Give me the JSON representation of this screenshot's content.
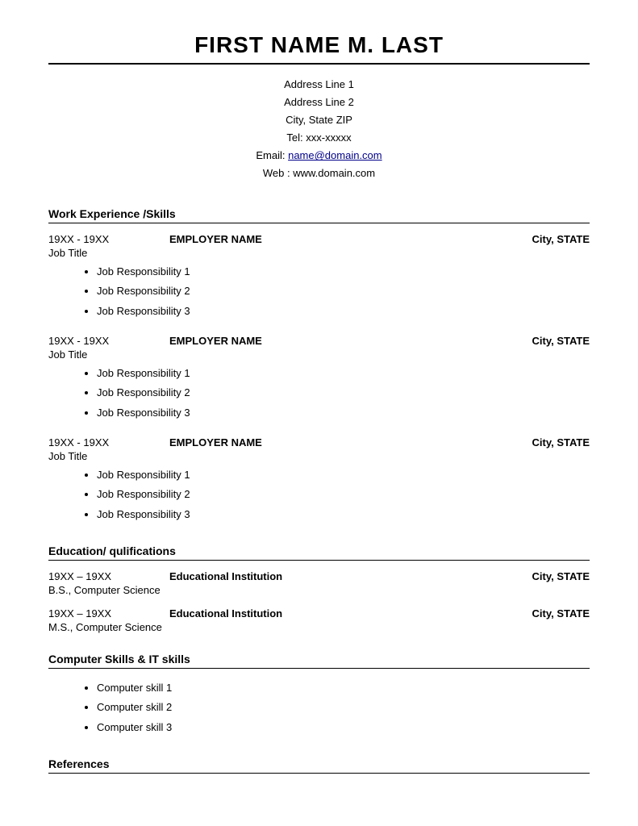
{
  "header": {
    "name": "FIRST NAME M. LAST",
    "address_line1": "Address Line 1",
    "address_line2": "Address Line 2",
    "city_state_zip": "City, State ZIP",
    "tel": "Tel: xxx-xxxxx",
    "email_label": "Email: ",
    "email_value": "name@domain.com",
    "email_href": "mailto:name@domain.com",
    "web": "Web : www.domain.com"
  },
  "work_section": {
    "title": "Work Experience /Skills",
    "jobs": [
      {
        "dates": "19XX - 19XX",
        "employer": "EMPLOYER NAME",
        "location": "City, STATE",
        "title": "Job Title",
        "responsibilities": [
          "Job Responsibility 1",
          "Job Responsibility 2",
          "Job Responsibility 3"
        ]
      },
      {
        "dates": "19XX - 19XX",
        "employer": "EMPLOYER NAME",
        "location": "City, STATE",
        "title": "Job Title",
        "responsibilities": [
          "Job Responsibility 1",
          "Job Responsibility 2",
          "Job Responsibility 3"
        ]
      },
      {
        "dates": "19XX - 19XX",
        "employer": "EMPLOYER NAME",
        "location": "City, STATE",
        "title": "Job Title",
        "responsibilities": [
          "Job Responsibility 1",
          "Job Responsibility 2",
          "Job Responsibility 3"
        ]
      }
    ]
  },
  "education_section": {
    "title": "Education/ qulifications",
    "entries": [
      {
        "dates": "19XX – 19XX",
        "institution": "Educational Institution",
        "location": "City, STATE",
        "degree": "B.S., Computer Science"
      },
      {
        "dates": "19XX – 19XX",
        "institution": "Educational Institution",
        "location": "City, STATE",
        "degree": "M.S., Computer Science"
      }
    ]
  },
  "skills_section": {
    "title": "Computer Skills & IT skills",
    "skills": [
      "Computer skill 1",
      "Computer skill 2",
      "Computer skill 3"
    ]
  },
  "references_section": {
    "title": "References"
  }
}
